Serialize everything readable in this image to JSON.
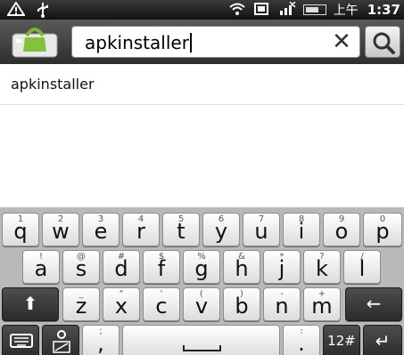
{
  "status_bar": {
    "ampm": "上午",
    "time": "1:37",
    "icons": [
      "warning-icon",
      "usb-icon",
      "wifi-icon",
      "storage-icon",
      "no-signal-icon",
      "battery-icon"
    ]
  },
  "search": {
    "query": "apkinstaller",
    "clear_glyph": "✕",
    "search_button": "search-icon"
  },
  "suggestions": [
    {
      "label": "apkinstaller"
    }
  ],
  "keyboard": {
    "row1": [
      {
        "alt": "1",
        "main": "q"
      },
      {
        "alt": "2",
        "main": "w"
      },
      {
        "alt": "3",
        "main": "e"
      },
      {
        "alt": "4",
        "main": "r"
      },
      {
        "alt": "5",
        "main": "t"
      },
      {
        "alt": "6",
        "main": "y"
      },
      {
        "alt": "7",
        "main": "u"
      },
      {
        "alt": "8",
        "main": "i"
      },
      {
        "alt": "9",
        "main": "o"
      },
      {
        "alt": "0",
        "main": "p"
      }
    ],
    "row2": [
      {
        "alt": "!",
        "main": "a"
      },
      {
        "alt": "@",
        "main": "s"
      },
      {
        "alt": "#",
        "main": "d"
      },
      {
        "alt": "$",
        "main": "f"
      },
      {
        "alt": "%",
        "main": "g"
      },
      {
        "alt": "&",
        "main": "h"
      },
      {
        "alt": "*",
        "main": "j"
      },
      {
        "alt": "?",
        "main": "k"
      },
      {
        "alt": "/",
        "main": "l"
      }
    ],
    "row3": [
      {
        "alt": "_",
        "main": "z"
      },
      {
        "alt": "\"",
        "main": "x"
      },
      {
        "alt": "'",
        "main": "c"
      },
      {
        "alt": "(",
        "main": "v"
      },
      {
        "alt": ")",
        "main": "b"
      },
      {
        "alt": "-",
        "main": "n"
      },
      {
        "alt": "+",
        "main": "m"
      }
    ],
    "shift_glyph": "⬆",
    "backspace_glyph": "←",
    "comma": {
      "alt": ";",
      "main": ","
    },
    "period": {
      "alt": ":",
      "main": "."
    },
    "symbols_label": "12#",
    "enter_glyph": "↵"
  }
}
